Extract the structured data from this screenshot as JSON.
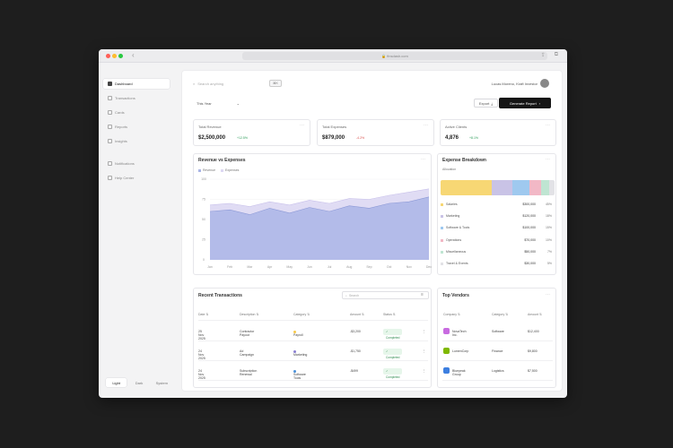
{
  "browser": {
    "url": "finsdash.com",
    "dots": [
      "#ff5f57",
      "#febc2e",
      "#28c840"
    ]
  },
  "sidebar": {
    "items": [
      {
        "label": "Dashboard",
        "icon": "dashboard-icon",
        "active": true
      },
      {
        "label": "Transactions",
        "icon": "transactions-icon",
        "active": false
      },
      {
        "label": "Cards",
        "icon": "card-icon",
        "active": false
      },
      {
        "label": "Reports",
        "icon": "report-icon",
        "active": false
      },
      {
        "label": "Insights",
        "icon": "insights-icon",
        "active": false
      },
      {
        "label": "Notifications",
        "icon": "bell-icon",
        "active": false
      },
      {
        "label": "Help Center",
        "icon": "help-icon",
        "active": false
      }
    ],
    "theme": [
      "Light",
      "Dark",
      "System"
    ]
  },
  "header": {
    "search_placeholder": "Search anything",
    "shortcut": "⌘K",
    "user_name": "Lucas Moreno, Kraft Investor"
  },
  "toolbar": {
    "date_range": "This Year",
    "export_label": "Export",
    "primary_label": "Generate Report"
  },
  "stats": [
    {
      "label": "Total Revenue",
      "value": "$2,500,000",
      "delta": "+12.5%",
      "delta_color": "#2e9e5b"
    },
    {
      "label": "Total Expenses",
      "value": "$879,000",
      "delta": "-4.2%",
      "delta_color": "#d9534f"
    },
    {
      "label": "Active Clients",
      "value": "4,876",
      "delta": "+8.1%",
      "delta_color": "#2e9e5b"
    }
  ],
  "revenue_chart": {
    "title": "Revenue vs Expenses",
    "legend": [
      "Revenue",
      "Expenses"
    ],
    "colors": {
      "revenue": "#aab5e6",
      "expenses": "#ddd8f3"
    }
  },
  "chart_data": {
    "type": "area",
    "categories": [
      "Jan",
      "Feb",
      "Mar",
      "Apr",
      "May",
      "Jun",
      "Jul",
      "Aug",
      "Sep",
      "Oct",
      "Nov",
      "Dec"
    ],
    "ylim": [
      0,
      100
    ],
    "yticks": [
      "100",
      "75",
      "50",
      "25",
      "0"
    ],
    "series": [
      {
        "name": "Revenue",
        "values": [
          60,
          62,
          56,
          64,
          58,
          65,
          60,
          67,
          64,
          70,
          72,
          78
        ]
      },
      {
        "name": "Expenses",
        "values": [
          68,
          70,
          66,
          72,
          68,
          74,
          70,
          76,
          75,
          80,
          84,
          88
        ]
      }
    ]
  },
  "expense_breakdown": {
    "title": "Expense Breakdown",
    "subtitle": "Allocation",
    "items": [
      {
        "name": "Salaries",
        "value": "$300,000",
        "pct": "45%",
        "color": "#f7d774",
        "share": 0.45
      },
      {
        "name": "Marketing",
        "value": "$120,000",
        "pct": "18%",
        "color": "#c9c3e6",
        "share": 0.18
      },
      {
        "name": "Software & Tools",
        "value": "$100,000",
        "pct": "15%",
        "color": "#9fc9ef",
        "share": 0.15
      },
      {
        "name": "Operations",
        "value": "$70,000",
        "pct": "10%",
        "color": "#f2b8c6",
        "share": 0.1
      },
      {
        "name": "Miscellaneous",
        "value": "$50,000",
        "pct": "7%",
        "color": "#bfe5d2",
        "share": 0.07
      },
      {
        "name": "Travel & Events",
        "value": "$30,000",
        "pct": "5%",
        "color": "#e2e2e6",
        "share": 0.05
      }
    ]
  },
  "transactions": {
    "title": "Recent Transactions",
    "search_placeholder": "Search",
    "columns": [
      "Date",
      "Description",
      "Category",
      "Amount",
      "Status"
    ],
    "rows": [
      {
        "date": "25 Nov 2025",
        "description": "Contractor Payout",
        "category": "Payroll",
        "cat_color": "#f7c948",
        "amount": "-$3,200",
        "status": "Completed"
      },
      {
        "date": "24 Nov 2025",
        "description": "Ad Campaign",
        "category": "Marketing",
        "cat_color": "#8a7fd1",
        "amount": "-$1,750",
        "status": "Completed"
      },
      {
        "date": "24 Nov 2025",
        "description": "Subscription Renewal",
        "category": "Software Tools",
        "cat_color": "#4a90d9",
        "amount": "-$499",
        "status": "Completed"
      }
    ]
  },
  "vendors": {
    "title": "Top Vendors",
    "columns": [
      "Company",
      "Category",
      "Amount"
    ],
    "rows": [
      {
        "name": "NovaTech Inc.",
        "category": "Software",
        "amount": "$12,400",
        "color": "#c86be0"
      },
      {
        "name": "LumenCorp",
        "category": "Finance",
        "amount": "$9,800",
        "color": "#7fb800"
      },
      {
        "name": "Bluepeak Group",
        "category": "Logistics",
        "amount": "$7,500",
        "color": "#3d7fe0"
      }
    ]
  }
}
